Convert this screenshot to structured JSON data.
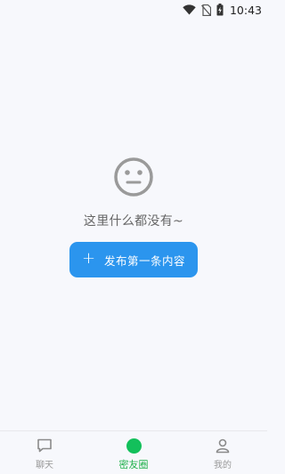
{
  "status_bar": {
    "time": "10:43",
    "icons": [
      "wifi-icon",
      "no-sim-icon",
      "battery-charging-icon"
    ]
  },
  "empty_state": {
    "icon": "neutral-face-icon",
    "message": "这里什么都没有~",
    "action": {
      "icon": "plus",
      "icon_glyph": "+",
      "label": "发布第一条内容"
    }
  },
  "bottom_nav": {
    "items": [
      {
        "label": "聊天",
        "icon": "chat-icon",
        "active": false
      },
      {
        "label": "密友圈",
        "icon": "green-dot-icon",
        "active": true
      },
      {
        "label": "我的",
        "icon": "user-icon",
        "active": false
      }
    ]
  },
  "colors": {
    "background": "#f7f8fc",
    "primary_button": "#2b95ee",
    "active_tab": "#1fb04a",
    "active_dot": "#13c05b",
    "inactive_tab": "#999999"
  }
}
